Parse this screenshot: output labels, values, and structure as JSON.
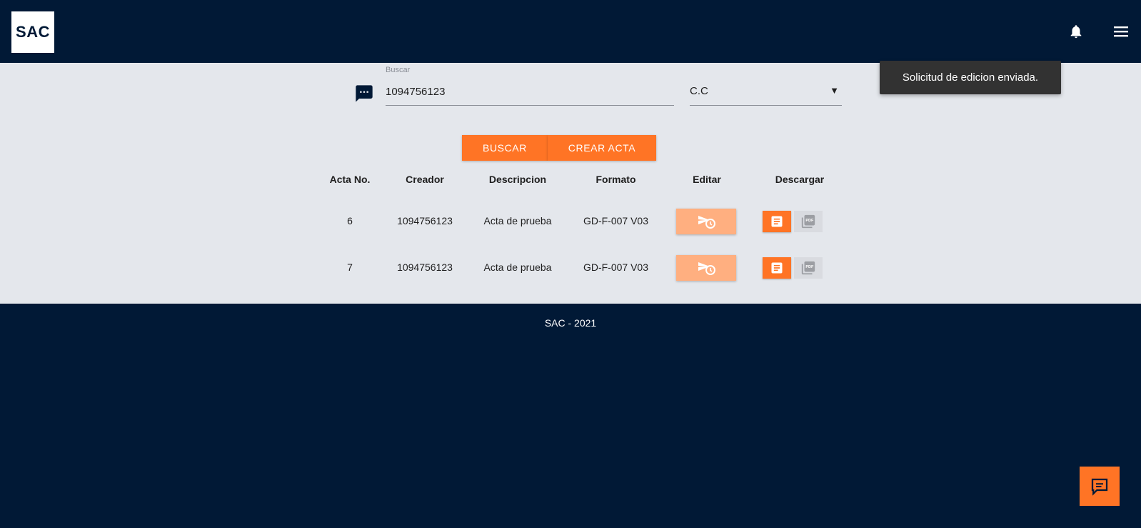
{
  "header": {
    "logo_text": "SAC",
    "icons": [
      "bell-icon",
      "menu-icon"
    ]
  },
  "search": {
    "label": "Buscar",
    "value": "1094756123",
    "doc_type": "C.C"
  },
  "buttons": {
    "buscar": "BUSCAR",
    "crear_acta": "CREAR ACTA"
  },
  "table": {
    "headers": [
      "Acta No.",
      "Creador",
      "Descripcion",
      "Formato",
      "Editar",
      "Descargar"
    ],
    "rows": [
      {
        "acta": "6",
        "creador": "1094756123",
        "descripcion": "Acta de prueba",
        "formato": "GD-F-007 V03"
      },
      {
        "acta": "7",
        "creador": "1094756123",
        "descripcion": "Acta de prueba",
        "formato": "GD-F-007 V03"
      }
    ]
  },
  "footer": {
    "text": "SAC - 2021"
  },
  "toast": {
    "message": "Solicitud de edicion enviada."
  },
  "colors": {
    "navy": "#011936",
    "accent": "#ff7425",
    "accent_light": "#ffaf80",
    "content_bg": "#e4e7ec"
  }
}
